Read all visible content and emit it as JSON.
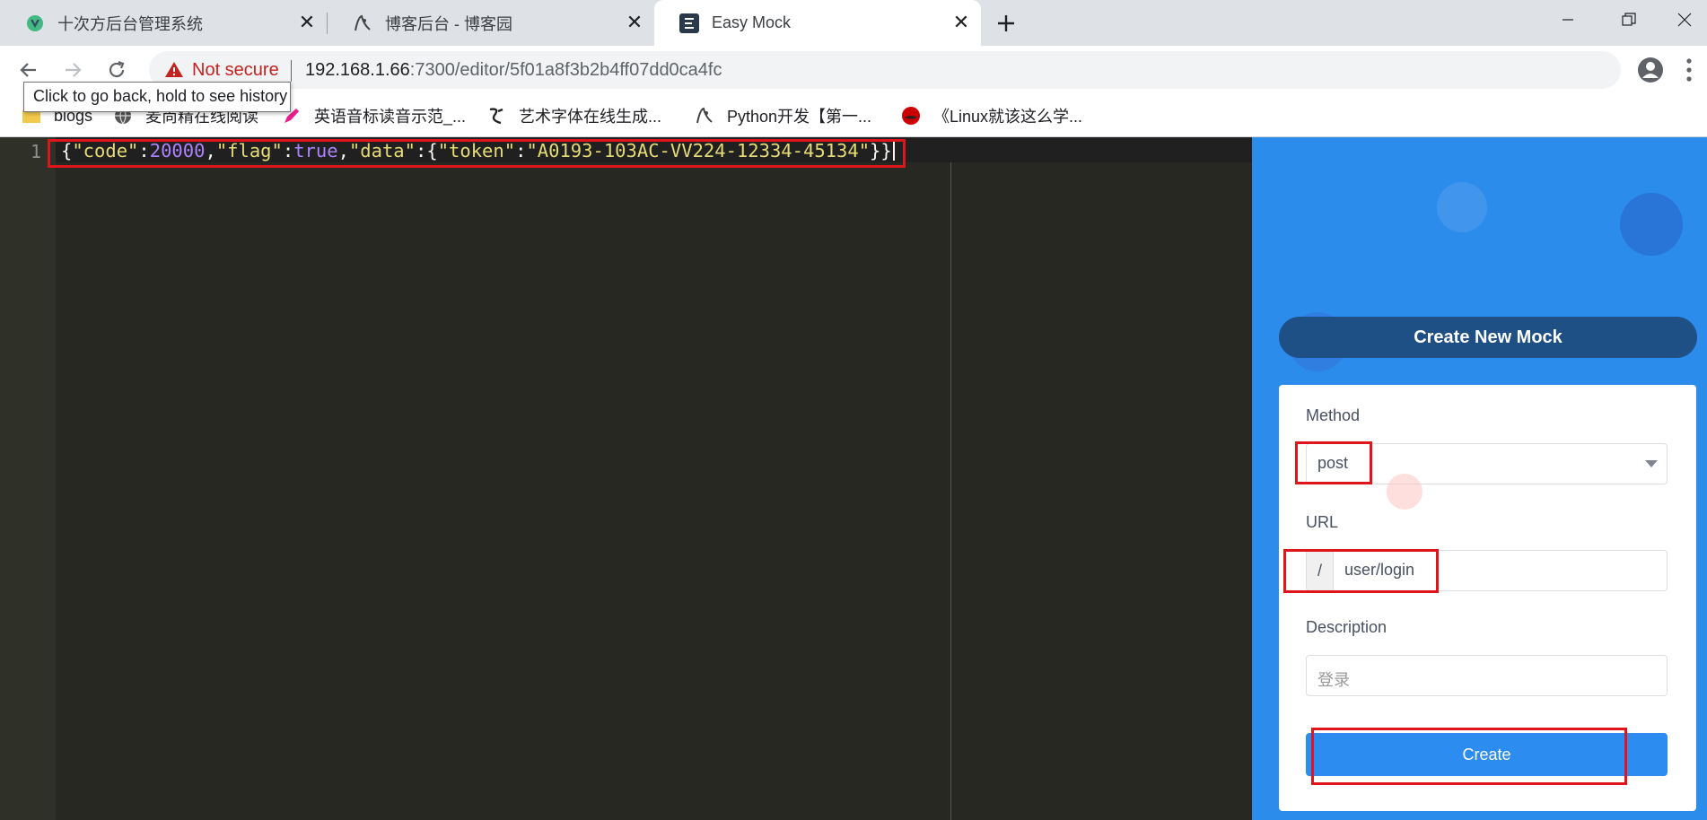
{
  "tabs": [
    {
      "title": "十次方后台管理系统",
      "favicon": "vue-icon",
      "active": false
    },
    {
      "title": "博客后台 - 博客园",
      "favicon": "cnblogs-icon",
      "active": false
    },
    {
      "title": "Easy Mock",
      "favicon": "easy-mock-icon",
      "active": true
    }
  ],
  "toolbar": {
    "security_label": "Not secure",
    "url_host": "192.168.1.66",
    "url_rest": ":7300/editor/5f01a8f3b2b4ff07dd0ca4fc",
    "back_tooltip": "Click to go back, hold to see history"
  },
  "bookmarks": [
    {
      "label": "blogs",
      "icon": "folder-icon"
    },
    {
      "label": "麦尚精在线阅读",
      "icon": "globe-icon"
    },
    {
      "label": "英语音标读音示范_...",
      "icon": "pen-icon"
    },
    {
      "label": "艺术字体在线生成...",
      "icon": "calligraphy-icon"
    },
    {
      "label": "Python开发【第一...",
      "icon": "cnblogs-icon"
    },
    {
      "label": "《Linux就该这么学...",
      "icon": "redhat-icon"
    }
  ],
  "editor": {
    "line_number": "1",
    "code": {
      "brace_open": "{",
      "key_code": "\"code\"",
      "colon": ":",
      "val_code": "20000",
      "comma": ",",
      "key_flag": "\"flag\"",
      "val_flag": "true",
      "key_data": "\"data\"",
      "brace_open2": "{",
      "key_token": "\"token\"",
      "val_token": "\"A0193-103AC-VV224-12334-45134\"",
      "brace_close": "}}"
    }
  },
  "panel": {
    "header": "Create New Mock",
    "method_label": "Method",
    "method_value": "post",
    "url_label": "URL",
    "url_prefix": "/",
    "url_value": "user/login",
    "description_label": "Description",
    "description_placeholder": "登录",
    "create_label": "Create"
  },
  "colors": {
    "editor_bg": "#272822",
    "panel_bg": "#2c8cec",
    "highlight": "#e0141b",
    "button": "#2d8cf0"
  }
}
